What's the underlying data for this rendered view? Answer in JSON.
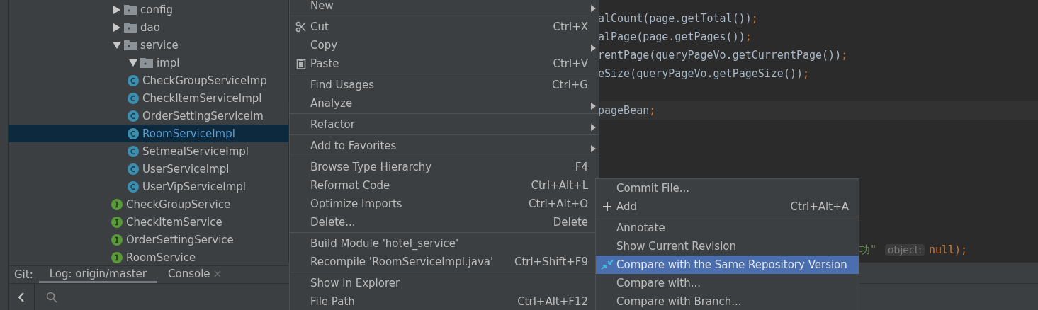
{
  "project_tree": [
    {
      "kind": "folder",
      "label": "config",
      "expanded": false,
      "selected": false
    },
    {
      "kind": "folder",
      "label": "dao",
      "expanded": false,
      "selected": false
    },
    {
      "kind": "folder",
      "label": "service",
      "expanded": true,
      "selected": false,
      "children": [
        {
          "kind": "folder",
          "label": "impl",
          "expanded": true,
          "selected": false,
          "children": [
            {
              "kind": "class",
              "label": "CheckGroupServiceImp",
              "selected": false
            },
            {
              "kind": "class",
              "label": "CheckItemServiceImpl",
              "selected": false
            },
            {
              "kind": "class",
              "label": "OrderSettingServiceIm",
              "selected": false
            },
            {
              "kind": "class",
              "label": "RoomServiceImpl",
              "selected": true
            },
            {
              "kind": "class",
              "label": "SetmealServiceImpl",
              "selected": false
            },
            {
              "kind": "class",
              "label": "UserServiceImpl",
              "selected": false
            },
            {
              "kind": "class",
              "label": "UserVipServiceImpl",
              "selected": false
            }
          ]
        },
        {
          "kind": "interface",
          "label": "CheckGroupService",
          "selected": false
        },
        {
          "kind": "interface",
          "label": "CheckItemService",
          "selected": false
        },
        {
          "kind": "interface",
          "label": "OrderSettingService",
          "selected": false
        },
        {
          "kind": "interface",
          "label": "RoomService",
          "selected": false
        }
      ]
    }
  ],
  "bottom_tabs": {
    "prefix": "Git:",
    "tabs": [
      {
        "label": "Log: origin/master",
        "selected": true,
        "closable": false
      },
      {
        "label": "Console",
        "selected": false,
        "closable": true
      }
    ]
  },
  "code_lines": [
    {
      "kind": "line",
      "segments": [
        {
          "kind": "plain",
          "text": "alCount(page.getTotal())"
        },
        {
          "kind": "punct",
          "text": ";"
        }
      ]
    },
    {
      "kind": "line",
      "segments": [
        {
          "kind": "plain",
          "text": "alPage(page.getPages())"
        },
        {
          "kind": "punct",
          "text": ";"
        }
      ]
    },
    {
      "kind": "line",
      "segments": [
        {
          "kind": "plain",
          "text": "rentPage(queryPageVo.getCurrentPage())"
        },
        {
          "kind": "punct",
          "text": ";"
        }
      ]
    },
    {
      "kind": "line",
      "segments": [
        {
          "kind": "plain",
          "text": "eSize(queryPageVo.getPageSize())"
        },
        {
          "kind": "punct",
          "text": ";"
        }
      ]
    },
    {
      "kind": "line"
    },
    {
      "kind": "caret_line",
      "segments": [
        {
          "kind": "plain",
          "text": "pageBean"
        },
        {
          "kind": "punct",
          "text": ";"
        }
      ]
    }
  ],
  "partial_code_line": [
    {
      "kind": "string",
      "text": "功\""
    },
    {
      "kind": "hint",
      "text": "object:"
    },
    {
      "kind": "punct",
      "text": "null);"
    }
  ],
  "context_menu": [
    {
      "kind": "item",
      "label": "New",
      "submenu": true
    },
    {
      "kind": "divider"
    },
    {
      "kind": "item",
      "label": "Cut",
      "shortcut": "Ctrl+X"
    },
    {
      "kind": "item",
      "label": "Copy",
      "submenu": true
    },
    {
      "kind": "item",
      "label": "Paste",
      "shortcut": "Ctrl+V"
    },
    {
      "kind": "divider"
    },
    {
      "kind": "item",
      "label": "Find Usages",
      "shortcut": "Ctrl+G"
    },
    {
      "kind": "item",
      "label": "Analyze",
      "submenu": true
    },
    {
      "kind": "divider"
    },
    {
      "kind": "item",
      "label": "Refactor",
      "submenu": true
    },
    {
      "kind": "divider"
    },
    {
      "kind": "item",
      "label": "Add to Favorites",
      "submenu": true
    },
    {
      "kind": "divider"
    },
    {
      "kind": "item",
      "label": "Browse Type Hierarchy",
      "shortcut": "F4"
    },
    {
      "kind": "item",
      "label": "Reformat Code",
      "shortcut": "Ctrl+Alt+L"
    },
    {
      "kind": "item",
      "label": "Optimize Imports",
      "shortcut": "Ctrl+Alt+O"
    },
    {
      "kind": "item",
      "label": "Delete...",
      "shortcut": "Delete"
    },
    {
      "kind": "divider"
    },
    {
      "kind": "item",
      "label": "Build Module 'hotel_service'"
    },
    {
      "kind": "item",
      "label": "Recompile 'RoomServiceImpl.java'",
      "shortcut": "Ctrl+Shift+F9"
    },
    {
      "kind": "divider"
    },
    {
      "kind": "item",
      "label": "Show in Explorer"
    },
    {
      "kind": "item",
      "label": "File Path",
      "shortcut": "Ctrl+Alt+F12"
    }
  ],
  "git_submenu": [
    {
      "kind": "item",
      "label": "Commit File...",
      "selected": false
    },
    {
      "kind": "item",
      "label": "Add",
      "shortcut": "Ctrl+Alt+A",
      "selected": false
    },
    {
      "kind": "divider"
    },
    {
      "kind": "item",
      "label": "Annotate",
      "selected": false
    },
    {
      "kind": "item",
      "label": "Show Current Revision",
      "selected": false
    },
    {
      "kind": "item",
      "label": "Compare with the Same Repository Version",
      "selected": true
    },
    {
      "kind": "item",
      "label": "Compare with...",
      "selected": false
    },
    {
      "kind": "item",
      "label": "Compare with Branch...",
      "selected": false
    }
  ]
}
